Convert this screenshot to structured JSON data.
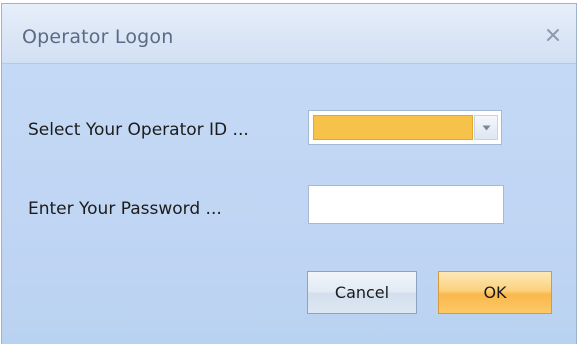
{
  "dialog": {
    "title": "Operator Logon",
    "close_icon": "close-icon"
  },
  "form": {
    "operator_label": "Select Your Operator ID ...",
    "operator_value": "",
    "operator_dropdown_icon": "chevron-down-icon",
    "password_label": "Enter Your Password ...",
    "password_value": "",
    "password_placeholder": ""
  },
  "buttons": {
    "cancel_label": "Cancel",
    "ok_label": "OK"
  },
  "colors": {
    "dialog_background": "#c6daf5",
    "titlebar_background": "#dbe6f6",
    "selected_field": "#f6c24a",
    "ok_button": "#f9b84c",
    "cancel_button": "#e2eaf4"
  }
}
